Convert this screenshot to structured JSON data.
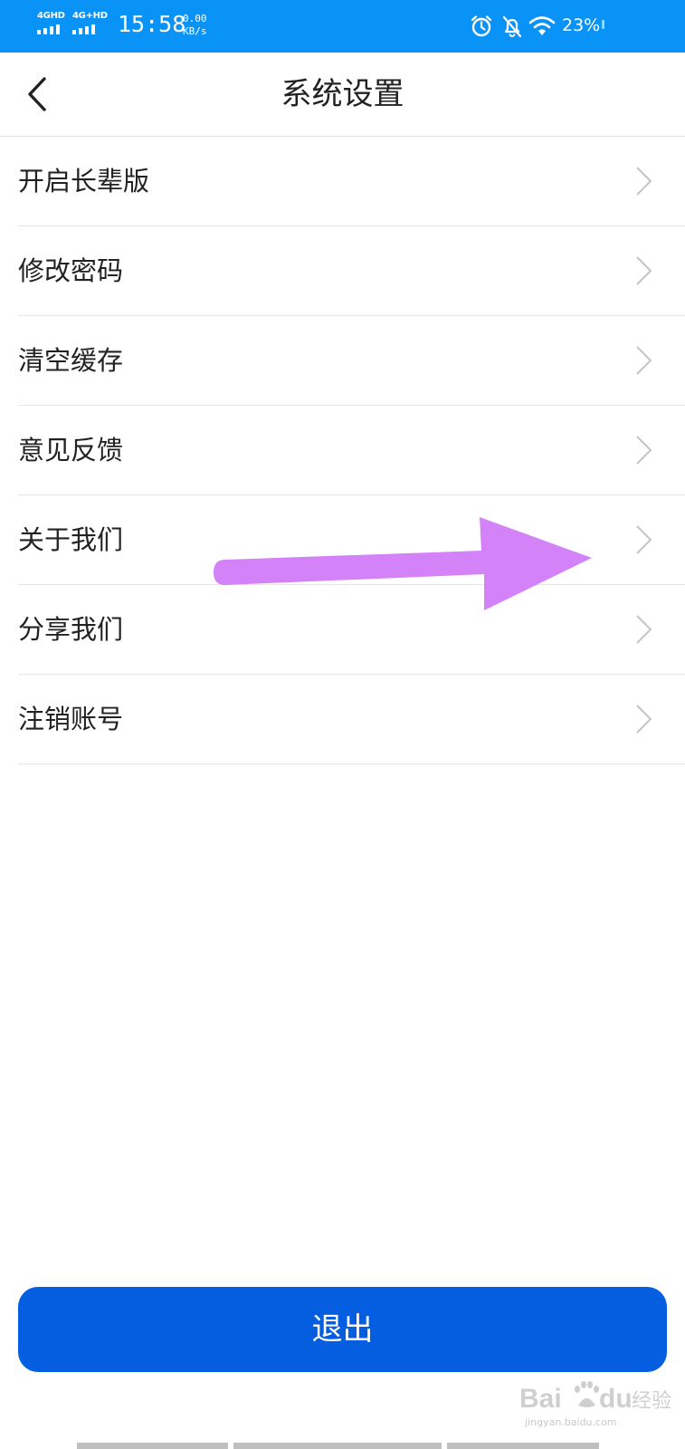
{
  "status_bar": {
    "network_1": "4GHD",
    "network_2": "4G+HD",
    "time": "15:58",
    "speed_value": "0.00",
    "speed_unit": "KB/s",
    "battery": "23%",
    "icons": [
      "signal-icon",
      "signal-icon",
      "alarm-clock-icon",
      "bell-muted-icon",
      "wifi-icon"
    ]
  },
  "header": {
    "title": "系统设置",
    "back_icon": "chevron-left-icon"
  },
  "settings": {
    "items": [
      {
        "label": "开启长辈版"
      },
      {
        "label": "修改密码"
      },
      {
        "label": "清空缓存"
      },
      {
        "label": "意见反馈"
      },
      {
        "label": "关于我们"
      },
      {
        "label": "分享我们"
      },
      {
        "label": "注销账号"
      }
    ],
    "item_icon": "chevron-right-icon"
  },
  "annotation": {
    "shape": "arrow",
    "color": "#d382f8"
  },
  "logout": {
    "label": "退出",
    "color": "#055de0"
  },
  "watermark": {
    "logo": "Baidu经验",
    "sub": "jingyan.baidu.com"
  },
  "colors": {
    "status_bar": "#0a93f6",
    "accent": "#055de0",
    "arrow": "#d382f8"
  }
}
